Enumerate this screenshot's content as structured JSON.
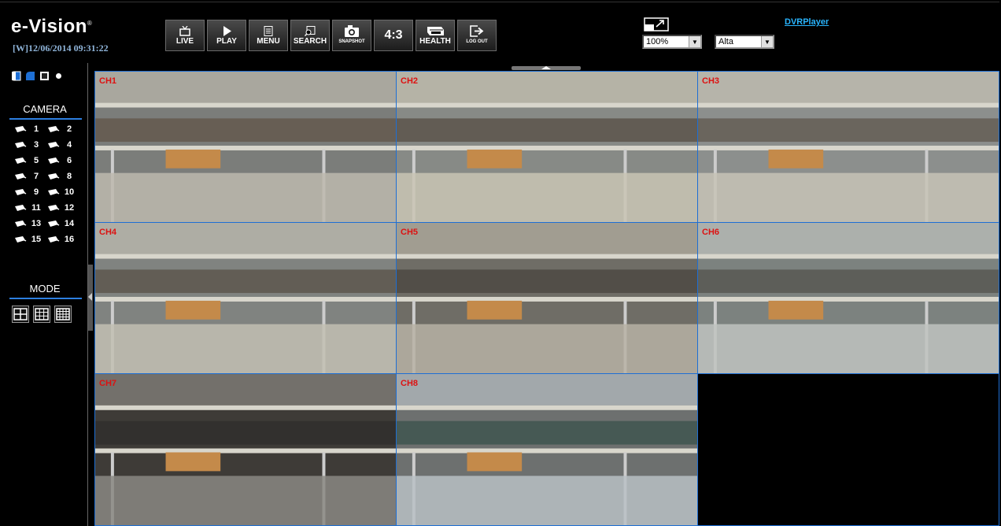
{
  "header": {
    "logo": "e-Vision",
    "logo_mark": "®",
    "datetime": "[W]12/06/2014   09:31:22",
    "toolbar": [
      {
        "name": "live",
        "label": "LIVE",
        "icon": "tv-icon"
      },
      {
        "name": "play",
        "label": "PLAY",
        "icon": "play-icon"
      },
      {
        "name": "menu",
        "label": "MENU",
        "icon": "menu-icon"
      },
      {
        "name": "search",
        "label": "SEARCH",
        "icon": "search-icon"
      },
      {
        "name": "snapshot",
        "label": "SNAPSHOT",
        "icon": "camera-icon"
      },
      {
        "name": "aspect",
        "label": "4:3",
        "icon": ""
      },
      {
        "name": "health",
        "label": "HEALTH",
        "icon": "hdd-icon"
      },
      {
        "name": "logout",
        "label": "LOG OUT",
        "icon": "logout-icon"
      }
    ],
    "zoom_select": "100%",
    "quality_select": "Alta",
    "dvr_player_link": "DVRPlayer"
  },
  "sidebar": {
    "camera_title": "CAMERA",
    "cameras": [
      "1",
      "2",
      "3",
      "4",
      "5",
      "6",
      "7",
      "8",
      "9",
      "10",
      "11",
      "12",
      "13",
      "14",
      "15",
      "16"
    ],
    "mode_title": "MODE"
  },
  "channels": [
    {
      "label": "CH1"
    },
    {
      "label": "CH2"
    },
    {
      "label": "CH3"
    },
    {
      "label": "CH4"
    },
    {
      "label": "CH5"
    },
    {
      "label": "CH6"
    },
    {
      "label": "CH7"
    },
    {
      "label": "CH8"
    },
    {
      "label": ""
    }
  ],
  "colors": {
    "accent": "#1e6fd4",
    "channel_label": "#dd1111",
    "link": "#29b5ff"
  }
}
